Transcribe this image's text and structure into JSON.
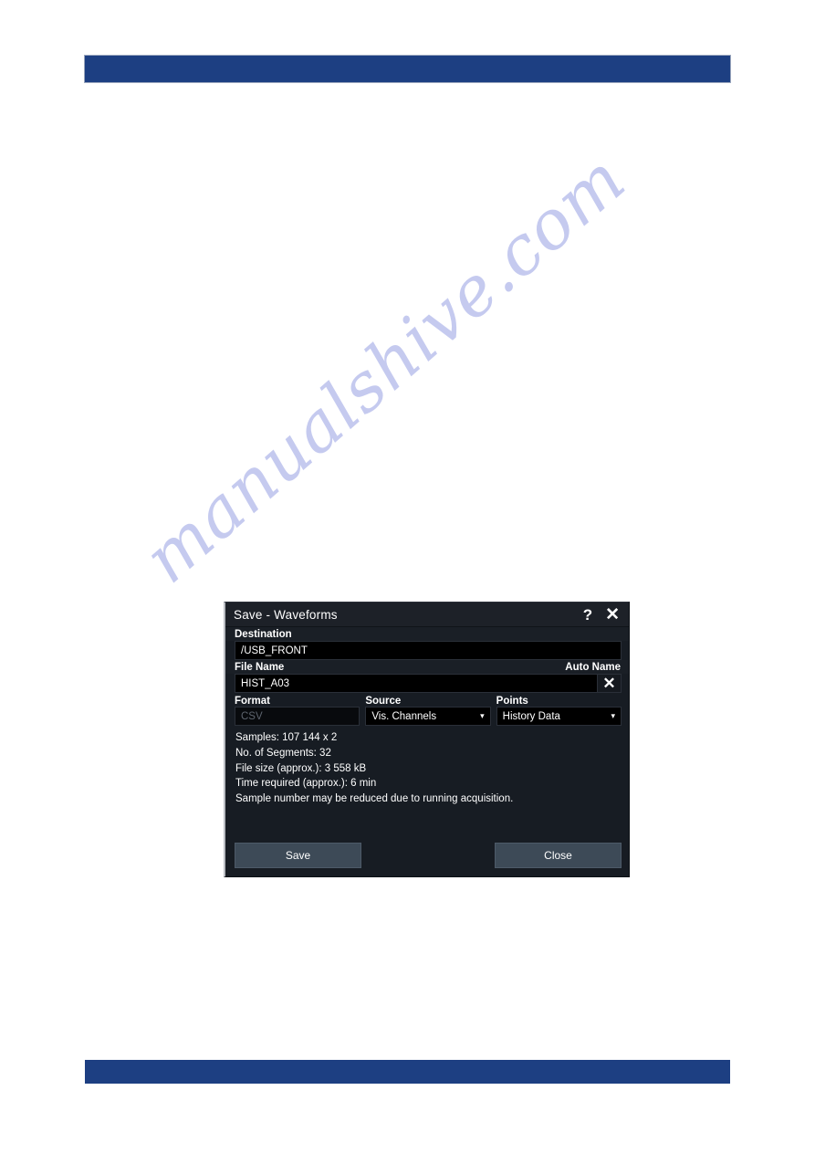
{
  "watermark": {
    "text": "manualshive.com"
  },
  "dialog": {
    "title": "Save - Waveforms",
    "help_icon": "?",
    "close_icon": "✕",
    "destination": {
      "label": "Destination",
      "value": "/USB_FRONT"
    },
    "file_name": {
      "label": "File Name",
      "auto_name_label": "Auto Name",
      "value": "HIST_A03",
      "clear_icon": "✕"
    },
    "selectors": [
      {
        "label": "Format",
        "value": "CSV",
        "disabled": true,
        "has_chevron": false
      },
      {
        "label": "Source",
        "value": "Vis. Channels",
        "disabled": false,
        "has_chevron": true
      },
      {
        "label": "Points",
        "value": "History Data",
        "disabled": false,
        "has_chevron": true
      }
    ],
    "chevron_icon": "▾",
    "info": [
      "Samples: 107 144 x 2",
      "No. of Segments: 32",
      "File size (approx.): 3 558 kB",
      "Time required (approx.): 6 min",
      "Sample number may be reduced due to running acquisition."
    ],
    "buttons": {
      "save_label": "Save",
      "close_label": "Close"
    }
  },
  "colors": {
    "accent_blue": "#1d3f82",
    "dialog_bg": "#171c23",
    "titlebar_bg": "#1d2128",
    "input_bg": "#000000",
    "button_bg": "#3d4a57",
    "watermark": "#c2c8ef"
  }
}
